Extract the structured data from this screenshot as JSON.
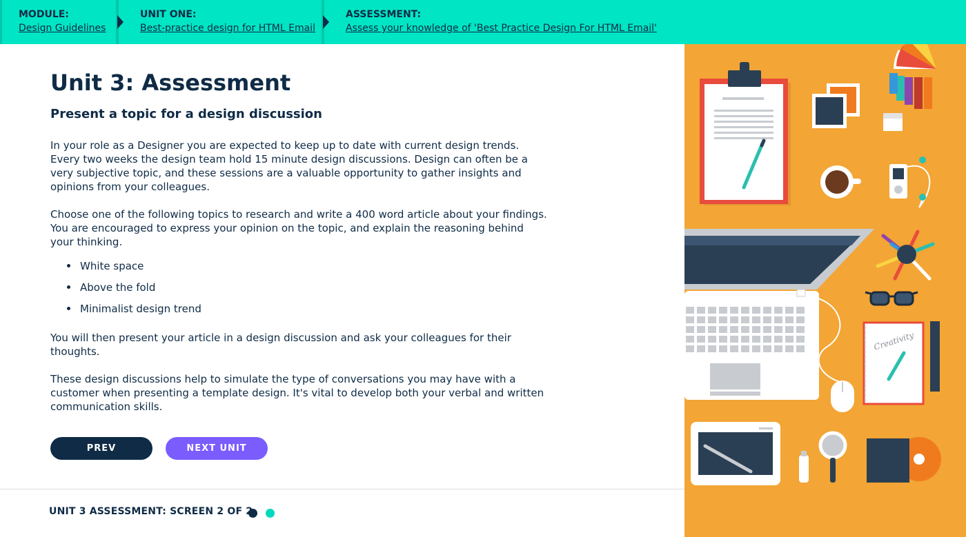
{
  "breadcrumb": {
    "module": {
      "label": "MODULE:",
      "link": "Design Guidelines"
    },
    "unit": {
      "label": "UNIT ONE:",
      "link": "Best-practice design for HTML Email"
    },
    "assessment": {
      "label": "ASSESSMENT:",
      "link": "Assess your knowledge of 'Best Practice Design For HTML Email'"
    }
  },
  "content": {
    "title": "Unit 3: Assessment",
    "subtitle": "Present a topic for a design discussion",
    "paragraph1": "In your role as a Designer you are expected to keep up to date with current design trends. Every two weeks the design team hold 15 minute design discussions. Design can often be a very subjective topic, and these sessions are a valuable opportunity to gather insights and opinions from your colleagues.",
    "paragraph2": "Choose one of the following topics to research and write a 400 word article about your findings. You are encouraged to express your opinion on the topic, and explain the reasoning behind your thinking.",
    "topics": [
      "White space",
      "Above the fold",
      "Minimalist design trend"
    ],
    "paragraph3": "You will then present your article in a design discussion and ask your colleagues for their thoughts.",
    "paragraph4": "These design discussions help to simulate the type of conversations you may have with a customer when presenting a template design. It's vital to develop both your verbal and written communication skills."
  },
  "buttons": {
    "prev": "PREV",
    "next": "NEXT UNIT"
  },
  "footer": {
    "status": "UNIT 3 ASSESSMENT: SCREEN 2 OF 2",
    "current_screen": 2,
    "total_screens": 2
  },
  "illustration": {
    "creativity_text": "Creativity",
    "colors": {
      "background": "#f3a535",
      "navy": "#2b3f54",
      "red": "#e94b3c",
      "white": "#ffffff",
      "teal": "#2bbfb0"
    }
  },
  "colors": {
    "accent_bar": "#00e5c4",
    "primary": "#0f2b46",
    "next_button": "#7a5cff",
    "dot_active": "#00d9bd"
  }
}
